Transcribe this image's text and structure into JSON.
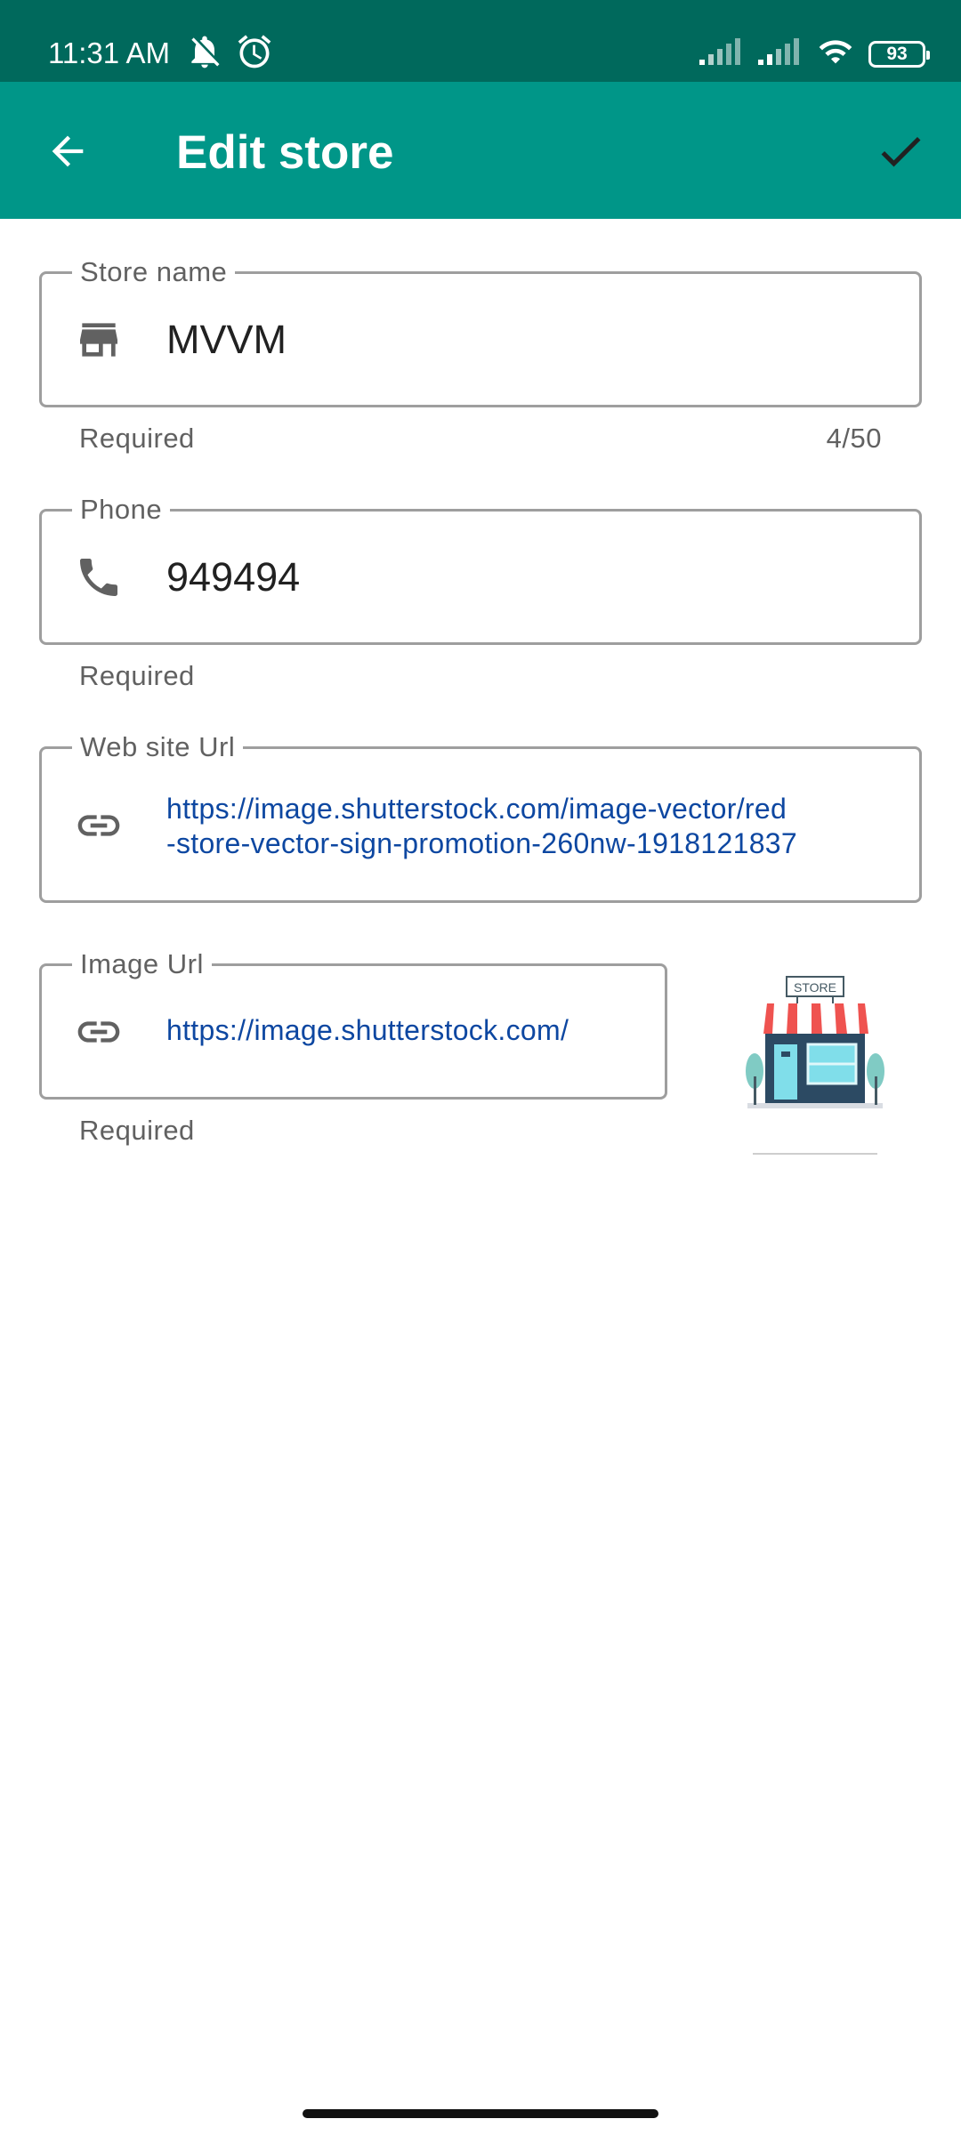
{
  "status_bar": {
    "time": "11:31 AM",
    "battery": "93",
    "icons": [
      "notifications-off-icon",
      "alarm-icon",
      "signal-icon",
      "signal-icon",
      "wifi-icon",
      "battery-icon"
    ]
  },
  "app_bar": {
    "title": "Edit store",
    "back_icon": "arrow-back-icon",
    "confirm_icon": "check-icon"
  },
  "form": {
    "store_name": {
      "label": "Store name",
      "value": "MVVM",
      "helper": "Required",
      "counter": "4/50",
      "icon": "store-icon"
    },
    "phone": {
      "label": "Phone",
      "value": "949494",
      "helper": "Required",
      "icon": "phone-icon"
    },
    "website": {
      "label": "Web site Url",
      "value_line1": "https://image.shutterstock.com/image-vector/red",
      "value_line2": "-store-vector-sign-promotion-260nw-1918121837",
      "icon": "link-icon"
    },
    "image_url": {
      "label": "Image Url",
      "value": "https://image.shutterstock.com/",
      "helper": "Required",
      "icon": "link-icon"
    },
    "thumbnail": {
      "sign_text": "STORE"
    }
  },
  "colors": {
    "status_bar": "#00695c",
    "app_bar": "#009688",
    "link": "#0d47a1",
    "outline": "#9e9e9e"
  }
}
